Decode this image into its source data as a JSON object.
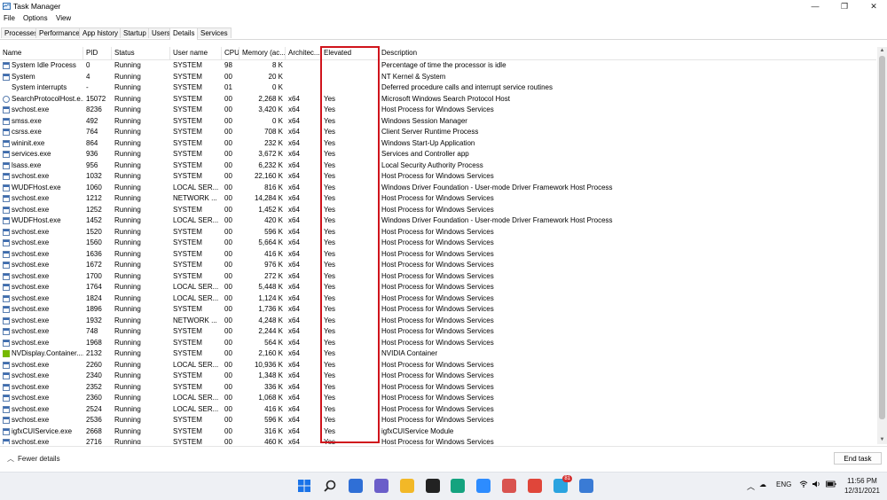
{
  "window": {
    "title": "Task Manager",
    "minimize": "—",
    "maximize": "❐",
    "close": "✕"
  },
  "menu": [
    "File",
    "Options",
    "View"
  ],
  "tabs": [
    {
      "label": "Processes",
      "active": false
    },
    {
      "label": "Performance",
      "active": false
    },
    {
      "label": "App history",
      "active": false
    },
    {
      "label": "Startup",
      "active": false
    },
    {
      "label": "Users",
      "active": false
    },
    {
      "label": "Details",
      "active": true
    },
    {
      "label": "Services",
      "active": false
    }
  ],
  "columns": [
    "Name",
    "PID",
    "Status",
    "User name",
    "CPU",
    "Memory (ac...",
    "Architec...",
    "Elevated",
    "Description"
  ],
  "rows": [
    {
      "icon": "win",
      "name": "System Idle Process",
      "pid": "0",
      "status": "Running",
      "user": "SYSTEM",
      "cpu": "98",
      "mem": "8 K",
      "arch": "",
      "elev": "",
      "desc": "Percentage of time the processor is idle"
    },
    {
      "icon": "win",
      "name": "System",
      "pid": "4",
      "status": "Running",
      "user": "SYSTEM",
      "cpu": "00",
      "mem": "20 K",
      "arch": "",
      "elev": "",
      "desc": "NT Kernel & System"
    },
    {
      "icon": "none",
      "name": "System interrupts",
      "pid": "-",
      "status": "Running",
      "user": "SYSTEM",
      "cpu": "01",
      "mem": "0 K",
      "arch": "",
      "elev": "",
      "desc": "Deferred procedure calls and interrupt service routines"
    },
    {
      "icon": "search",
      "name": "SearchProtocolHost.e...",
      "pid": "15072",
      "status": "Running",
      "user": "SYSTEM",
      "cpu": "00",
      "mem": "2,268 K",
      "arch": "x64",
      "elev": "Yes",
      "desc": "Microsoft Windows Search Protocol Host"
    },
    {
      "icon": "win",
      "name": "svchost.exe",
      "pid": "8236",
      "status": "Running",
      "user": "SYSTEM",
      "cpu": "00",
      "mem": "3,420 K",
      "arch": "x64",
      "elev": "Yes",
      "desc": "Host Process for Windows Services"
    },
    {
      "icon": "win",
      "name": "smss.exe",
      "pid": "492",
      "status": "Running",
      "user": "SYSTEM",
      "cpu": "00",
      "mem": "0 K",
      "arch": "x64",
      "elev": "Yes",
      "desc": "Windows Session Manager"
    },
    {
      "icon": "win",
      "name": "csrss.exe",
      "pid": "764",
      "status": "Running",
      "user": "SYSTEM",
      "cpu": "00",
      "mem": "708 K",
      "arch": "x64",
      "elev": "Yes",
      "desc": "Client Server Runtime Process"
    },
    {
      "icon": "win",
      "name": "wininit.exe",
      "pid": "864",
      "status": "Running",
      "user": "SYSTEM",
      "cpu": "00",
      "mem": "232 K",
      "arch": "x64",
      "elev": "Yes",
      "desc": "Windows Start-Up Application"
    },
    {
      "icon": "win",
      "name": "services.exe",
      "pid": "936",
      "status": "Running",
      "user": "SYSTEM",
      "cpu": "00",
      "mem": "3,672 K",
      "arch": "x64",
      "elev": "Yes",
      "desc": "Services and Controller app"
    },
    {
      "icon": "win",
      "name": "lsass.exe",
      "pid": "956",
      "status": "Running",
      "user": "SYSTEM",
      "cpu": "00",
      "mem": "6,232 K",
      "arch": "x64",
      "elev": "Yes",
      "desc": "Local Security Authority Process"
    },
    {
      "icon": "win",
      "name": "svchost.exe",
      "pid": "1032",
      "status": "Running",
      "user": "SYSTEM",
      "cpu": "00",
      "mem": "22,160 K",
      "arch": "x64",
      "elev": "Yes",
      "desc": "Host Process for Windows Services"
    },
    {
      "icon": "win",
      "name": "WUDFHost.exe",
      "pid": "1060",
      "status": "Running",
      "user": "LOCAL SER...",
      "cpu": "00",
      "mem": "816 K",
      "arch": "x64",
      "elev": "Yes",
      "desc": "Windows Driver Foundation - User-mode Driver Framework Host Process"
    },
    {
      "icon": "win",
      "name": "svchost.exe",
      "pid": "1212",
      "status": "Running",
      "user": "NETWORK ...",
      "cpu": "00",
      "mem": "14,284 K",
      "arch": "x64",
      "elev": "Yes",
      "desc": "Host Process for Windows Services"
    },
    {
      "icon": "win",
      "name": "svchost.exe",
      "pid": "1252",
      "status": "Running",
      "user": "SYSTEM",
      "cpu": "00",
      "mem": "1,452 K",
      "arch": "x64",
      "elev": "Yes",
      "desc": "Host Process for Windows Services"
    },
    {
      "icon": "win",
      "name": "WUDFHost.exe",
      "pid": "1452",
      "status": "Running",
      "user": "LOCAL SER...",
      "cpu": "00",
      "mem": "420 K",
      "arch": "x64",
      "elev": "Yes",
      "desc": "Windows Driver Foundation - User-mode Driver Framework Host Process"
    },
    {
      "icon": "win",
      "name": "svchost.exe",
      "pid": "1520",
      "status": "Running",
      "user": "SYSTEM",
      "cpu": "00",
      "mem": "596 K",
      "arch": "x64",
      "elev": "Yes",
      "desc": "Host Process for Windows Services"
    },
    {
      "icon": "win",
      "name": "svchost.exe",
      "pid": "1560",
      "status": "Running",
      "user": "SYSTEM",
      "cpu": "00",
      "mem": "5,664 K",
      "arch": "x64",
      "elev": "Yes",
      "desc": "Host Process for Windows Services"
    },
    {
      "icon": "win",
      "name": "svchost.exe",
      "pid": "1636",
      "status": "Running",
      "user": "SYSTEM",
      "cpu": "00",
      "mem": "416 K",
      "arch": "x64",
      "elev": "Yes",
      "desc": "Host Process for Windows Services"
    },
    {
      "icon": "win",
      "name": "svchost.exe",
      "pid": "1672",
      "status": "Running",
      "user": "SYSTEM",
      "cpu": "00",
      "mem": "976 K",
      "arch": "x64",
      "elev": "Yes",
      "desc": "Host Process for Windows Services"
    },
    {
      "icon": "win",
      "name": "svchost.exe",
      "pid": "1700",
      "status": "Running",
      "user": "SYSTEM",
      "cpu": "00",
      "mem": "272 K",
      "arch": "x64",
      "elev": "Yes",
      "desc": "Host Process for Windows Services"
    },
    {
      "icon": "win",
      "name": "svchost.exe",
      "pid": "1764",
      "status": "Running",
      "user": "LOCAL SER...",
      "cpu": "00",
      "mem": "5,448 K",
      "arch": "x64",
      "elev": "Yes",
      "desc": "Host Process for Windows Services"
    },
    {
      "icon": "win",
      "name": "svchost.exe",
      "pid": "1824",
      "status": "Running",
      "user": "LOCAL SER...",
      "cpu": "00",
      "mem": "1,124 K",
      "arch": "x64",
      "elev": "Yes",
      "desc": "Host Process for Windows Services"
    },
    {
      "icon": "win",
      "name": "svchost.exe",
      "pid": "1896",
      "status": "Running",
      "user": "SYSTEM",
      "cpu": "00",
      "mem": "1,736 K",
      "arch": "x64",
      "elev": "Yes",
      "desc": "Host Process for Windows Services"
    },
    {
      "icon": "win",
      "name": "svchost.exe",
      "pid": "1932",
      "status": "Running",
      "user": "NETWORK ...",
      "cpu": "00",
      "mem": "4,248 K",
      "arch": "x64",
      "elev": "Yes",
      "desc": "Host Process for Windows Services"
    },
    {
      "icon": "win",
      "name": "svchost.exe",
      "pid": "748",
      "status": "Running",
      "user": "SYSTEM",
      "cpu": "00",
      "mem": "2,244 K",
      "arch": "x64",
      "elev": "Yes",
      "desc": "Host Process for Windows Services"
    },
    {
      "icon": "win",
      "name": "svchost.exe",
      "pid": "1968",
      "status": "Running",
      "user": "SYSTEM",
      "cpu": "00",
      "mem": "564 K",
      "arch": "x64",
      "elev": "Yes",
      "desc": "Host Process for Windows Services"
    },
    {
      "icon": "nv",
      "name": "NVDisplay.Container....",
      "pid": "2132",
      "status": "Running",
      "user": "SYSTEM",
      "cpu": "00",
      "mem": "2,160 K",
      "arch": "x64",
      "elev": "Yes",
      "desc": "NVIDIA Container"
    },
    {
      "icon": "win",
      "name": "svchost.exe",
      "pid": "2260",
      "status": "Running",
      "user": "LOCAL SER...",
      "cpu": "00",
      "mem": "10,936 K",
      "arch": "x64",
      "elev": "Yes",
      "desc": "Host Process for Windows Services"
    },
    {
      "icon": "win",
      "name": "svchost.exe",
      "pid": "2340",
      "status": "Running",
      "user": "SYSTEM",
      "cpu": "00",
      "mem": "1,348 K",
      "arch": "x64",
      "elev": "Yes",
      "desc": "Host Process for Windows Services"
    },
    {
      "icon": "win",
      "name": "svchost.exe",
      "pid": "2352",
      "status": "Running",
      "user": "SYSTEM",
      "cpu": "00",
      "mem": "336 K",
      "arch": "x64",
      "elev": "Yes",
      "desc": "Host Process for Windows Services"
    },
    {
      "icon": "win",
      "name": "svchost.exe",
      "pid": "2360",
      "status": "Running",
      "user": "LOCAL SER...",
      "cpu": "00",
      "mem": "1,068 K",
      "arch": "x64",
      "elev": "Yes",
      "desc": "Host Process for Windows Services"
    },
    {
      "icon": "win",
      "name": "svchost.exe",
      "pid": "2524",
      "status": "Running",
      "user": "LOCAL SER...",
      "cpu": "00",
      "mem": "416 K",
      "arch": "x64",
      "elev": "Yes",
      "desc": "Host Process for Windows Services"
    },
    {
      "icon": "win",
      "name": "svchost.exe",
      "pid": "2536",
      "status": "Running",
      "user": "SYSTEM",
      "cpu": "00",
      "mem": "596 K",
      "arch": "x64",
      "elev": "Yes",
      "desc": "Host Process for Windows Services"
    },
    {
      "icon": "win",
      "name": "igfxCUIService.exe",
      "pid": "2668",
      "status": "Running",
      "user": "SYSTEM",
      "cpu": "00",
      "mem": "316 K",
      "arch": "x64",
      "elev": "Yes",
      "desc": "igfxCUIService Module"
    },
    {
      "icon": "win",
      "name": "svchost.exe",
      "pid": "2716",
      "status": "Running",
      "user": "SYSTEM",
      "cpu": "00",
      "mem": "460 K",
      "arch": "x64",
      "elev": "Yes",
      "desc": "Host Process for Windows Services"
    }
  ],
  "footer": {
    "fewer_details": "Fewer details",
    "end_task": "End task"
  },
  "taskbar": {
    "icons": [
      {
        "name": "start-icon",
        "color": "#1a73e8"
      },
      {
        "name": "search-icon",
        "color": "#2b2b2b"
      },
      {
        "name": "task-view-icon",
        "color": "#2f6fd6"
      },
      {
        "name": "teams-chat-icon",
        "color": "#6b5ec9"
      },
      {
        "name": "file-explorer-icon",
        "color": "#f2b827"
      },
      {
        "name": "notion-icon",
        "color": "#222222"
      },
      {
        "name": "edge-icon",
        "color": "#14a37f"
      },
      {
        "name": "zoom-icon",
        "color": "#2d8cff"
      },
      {
        "name": "photos-icon",
        "color": "#d9534f"
      },
      {
        "name": "chrome-icon",
        "color": "#e0463a"
      },
      {
        "name": "telegram-icon",
        "color": "#2aa3df"
      },
      {
        "name": "task-manager-icon",
        "color": "#3a7bd5"
      }
    ],
    "telegram_badge": "81",
    "lang": "ENG",
    "time": "11:56 PM",
    "date": "12/31/2021"
  }
}
